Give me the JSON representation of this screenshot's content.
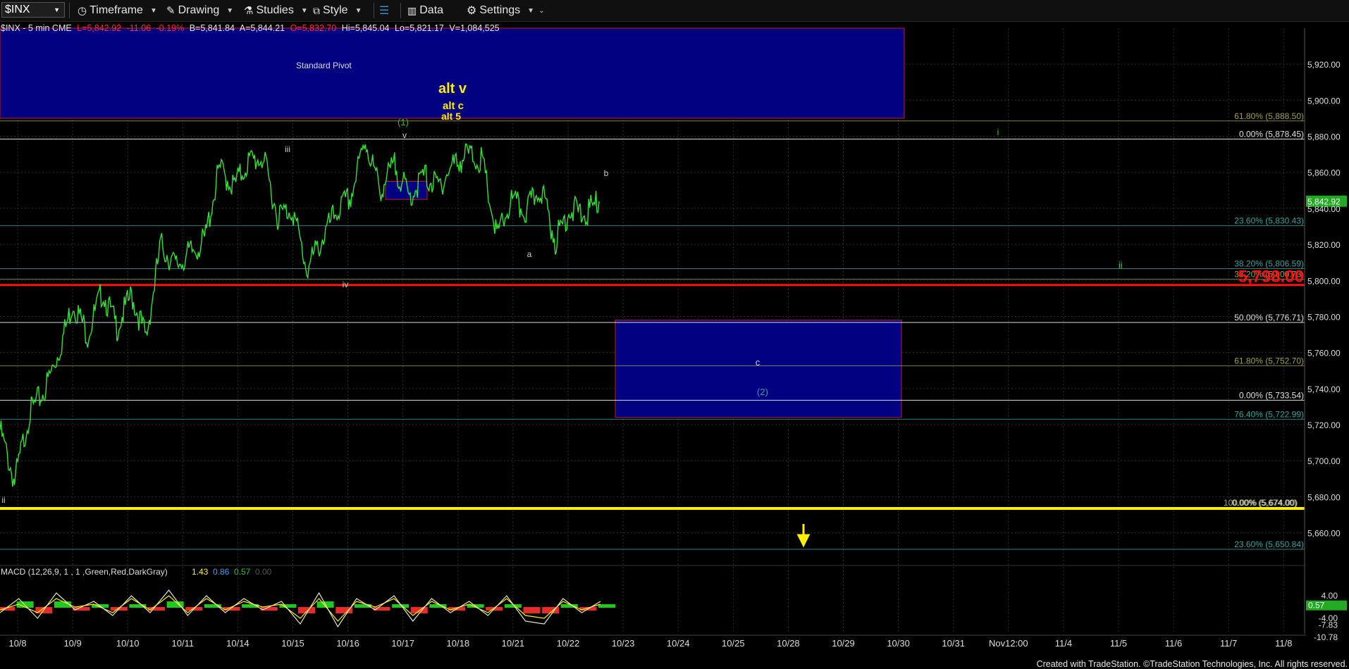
{
  "toolbar": {
    "symbol": "$INX",
    "items": [
      {
        "name": "timeframe-menu",
        "label": "Timeframe",
        "icon": "clock-icon"
      },
      {
        "name": "drawing-menu",
        "label": "Drawing",
        "icon": "pencil-icon"
      },
      {
        "name": "studies-menu",
        "label": "Studies",
        "icon": "flask-icon"
      },
      {
        "name": "style-menu",
        "label": "Style",
        "icon": "style-icon"
      },
      {
        "name": "data-menu",
        "label": "Data",
        "icon": "bar-chart-icon"
      },
      {
        "name": "settings-menu",
        "label": "Settings",
        "icon": "gear-icon"
      }
    ]
  },
  "info": {
    "symbol": "$INX - 5 min  CME",
    "last": "L=5,842.92",
    "change": "-11.06",
    "pct": "-0.19%",
    "bid": "B=5,841.84",
    "ask": "A=5,844.21",
    "open": "O=5,832.70",
    "high": "Hi=5,845.04",
    "low": "Lo=5,821.17",
    "volume": "V=1,084,525"
  },
  "colors": {
    "up": "#22dd22",
    "down": "#ff3030",
    "price_line": "#35e035",
    "zone": "#000080",
    "zone_border": "#c02020",
    "pivot_line": "#ff1010",
    "yellow": "#ffee00",
    "fib_text": "#3aa0a0",
    "fib_olive": "#a0a050"
  },
  "chart_data": {
    "type": "line",
    "price_series": {
      "name": "$INX",
      "x": [
        "10/8 09:30",
        "10/8 10:30",
        "10/8 12:00",
        "10/8 14:00",
        "10/9 10:00",
        "10/9 13:00",
        "10/9 15:30",
        "10/10 10:00",
        "10/10 12:00",
        "10/10 14:00",
        "10/10 15:30",
        "10/11 10:30",
        "10/11 12:00",
        "10/11 14:00",
        "10/11 15:50",
        "10/14 10:30",
        "10/14 13:00",
        "10/14 15:30",
        "10/15 10:00",
        "10/15 12:00",
        "10/15 15:30",
        "10/16 09:40",
        "10/16 11:00",
        "10/16 14:00",
        "10/16 15:50",
        "10/17 09:35",
        "10/17 10:30",
        "10/17 12:00",
        "10/17 14:00",
        "10/17 15:30",
        "10/18 10:00",
        "10/18 12:00",
        "10/18 14:30",
        "10/18 15:50",
        "10/21 10:00",
        "10/21 12:00",
        "10/21 14:00",
        "10/21 15:50",
        "10/22 09:40",
        "10/22 11:00",
        "10/22 13:00",
        "10/22 15:00"
      ],
      "y": [
        5717,
        5688,
        5726,
        5738,
        5760,
        5788,
        5770,
        5794,
        5774,
        5792,
        5768,
        5820,
        5808,
        5815,
        5822,
        5862,
        5852,
        5866,
        5868,
        5836,
        5840,
        5806,
        5822,
        5838,
        5846,
        5878,
        5850,
        5864,
        5846,
        5858,
        5852,
        5864,
        5870,
        5866,
        5824,
        5844,
        5838,
        5852,
        5822,
        5840,
        5836,
        5844
      ]
    },
    "y_ticks": [
      "5,920.00",
      "5,900.00",
      "5,880.00",
      "5,860.00",
      "5,840.00",
      "5,820.00",
      "5,800.00",
      "5,780.00",
      "5,760.00",
      "5,740.00",
      "5,720.00",
      "5,700.00",
      "5,680.00",
      "5,660.00"
    ],
    "y_range": [
      5645,
      5940
    ],
    "x_ticks": [
      "10/8",
      "10/9",
      "10/10",
      "10/11",
      "10/14",
      "10/15",
      "10/16",
      "10/17",
      "10/18",
      "10/21",
      "10/22",
      "10/23",
      "10/24",
      "10/25",
      "10/28",
      "10/29",
      "10/30",
      "10/31",
      "Nov12:00",
      "11/4",
      "11/5",
      "11/6",
      "11/7",
      "11/8"
    ],
    "last_price_label": "5,842.92",
    "fib_levels": [
      {
        "label": "61.80% (5,888.50)",
        "value": 5888.5,
        "color": "#a0a050"
      },
      {
        "label": "0.00% (5,878.45)",
        "value": 5878.45,
        "color": "#ffffff"
      },
      {
        "label": "23.60% (5,830.43)",
        "value": 5830.43,
        "color": "#3aa0a0"
      },
      {
        "label": "38.20% (5,806.59)",
        "value": 5806.59,
        "color": "#3aa0a0"
      },
      {
        "label": "38.20% (5,800.73)",
        "value": 5800.73,
        "color": "#a0a050"
      },
      {
        "label": "50.00% (5,776.71)",
        "value": 5776.71,
        "color": "#ffffff"
      },
      {
        "label": "61.80% (5,752.70)",
        "value": 5752.7,
        "color": "#a0a050"
      },
      {
        "label": "0.00% (5,733.54)",
        "value": 5733.54,
        "color": "#ffffff"
      },
      {
        "label": "76.40% (5,722.99)",
        "value": 5722.99,
        "color": "#3aa0a0"
      },
      {
        "label": "100.00% (5,674.00)",
        "value": 5674.0,
        "color": "#a0a050"
      },
      {
        "label": "0.00% (5,674.00)",
        "value": 5674.0,
        "color": "#ffffff"
      },
      {
        "label": "23.60% (5,650.84)",
        "value": 5650.84,
        "color": "#3aa0a0"
      }
    ],
    "pivot_line": {
      "label": "5,798.00",
      "value": 5797.5
    },
    "yellow_line": {
      "value": 5673.5
    },
    "pivot_zone": {
      "label": "Standard Pivot",
      "top": 5940,
      "bottom": 5890
    },
    "small_box": {
      "top": 5855,
      "bottom": 5845
    },
    "target_zone": {
      "top": 5778,
      "bottom": 5724
    },
    "wave_labels": [
      {
        "text": "alt v",
        "color": "#ffee00",
        "big": true
      },
      {
        "text": "alt c",
        "color": "#ffee00",
        "big": false
      },
      {
        "text": "alt 5",
        "color": "#ffee00",
        "big": false
      },
      {
        "text": "(1)",
        "color": "#3ab03a"
      },
      {
        "text": "v",
        "color": "#cccccc"
      },
      {
        "text": "iii",
        "color": "#cccccc"
      },
      {
        "text": "iv",
        "color": "#cccccc"
      },
      {
        "text": "ii",
        "color": "#cccccc"
      },
      {
        "text": "a",
        "color": "#cccccc"
      },
      {
        "text": "b",
        "color": "#cccccc"
      },
      {
        "text": "c",
        "color": "#cccccc"
      },
      {
        "text": "(2)",
        "color": "#3aa0a0"
      },
      {
        "text": "i",
        "color": "#22cc22"
      },
      {
        "text": "ii",
        "color": "#22cc22"
      }
    ],
    "macd": {
      "title": "MACD (12,26,9, 1 , 1 ,Green,Red,DarkGray)",
      "values": [
        "1.43",
        "0.86",
        "0.57",
        "0.00"
      ],
      "value_colors": [
        "#ffee00",
        "#3aa0ff",
        "#22cc22",
        "#555555"
      ],
      "y_ticks": [
        "4.00",
        "-4.00",
        "-7.83",
        "-10.78"
      ],
      "last_label": "0.57",
      "macd_line": [
        -2,
        3,
        -4,
        5,
        -1,
        2,
        -3,
        4,
        -2,
        6,
        -3,
        4,
        -2,
        3,
        -1,
        2,
        -6,
        5,
        -7,
        3,
        -1,
        4,
        -5,
        3,
        -2,
        2,
        -3,
        4,
        -5,
        -6,
        3,
        -2,
        2
      ],
      "signal_line": [
        -1,
        1,
        -2,
        3,
        0,
        1,
        -2,
        3,
        -1,
        4,
        -2,
        3,
        -1,
        2,
        0,
        1,
        -4,
        3,
        -5,
        2,
        0,
        3,
        -3,
        2,
        -1,
        1,
        -2,
        3,
        -3,
        -4,
        2,
        -1,
        1
      ],
      "histogram": [
        -1,
        2,
        -2,
        2,
        -1,
        1,
        -1,
        1,
        -1,
        2,
        -1,
        1,
        -1,
        1,
        -1,
        1,
        -2,
        2,
        -2,
        1,
        -1,
        1,
        -2,
        1,
        -1,
        1,
        -1,
        1,
        -2,
        -2,
        1,
        -1,
        1
      ]
    }
  },
  "footer": "Created with TradeStation. ©TradeStation Technologies, Inc. All rights reserved."
}
